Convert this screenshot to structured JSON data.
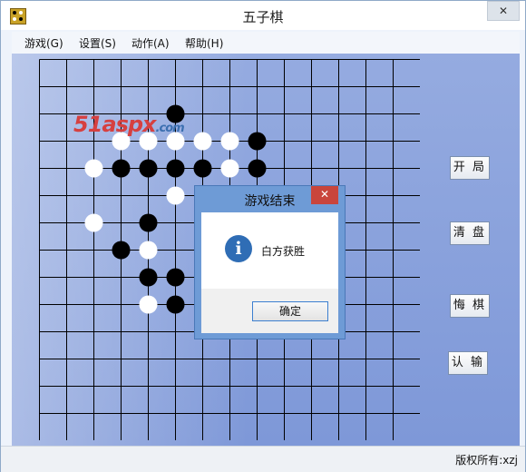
{
  "window": {
    "title": "五子棋",
    "close_label": "✕"
  },
  "menu": [
    {
      "label": "游戏(G)"
    },
    {
      "label": "设置(S)"
    },
    {
      "label": "动作(A)"
    },
    {
      "label": "帮助(H)"
    }
  ],
  "buttons": {
    "start": "开 局",
    "clear": "清 盘",
    "undo": "悔 棋",
    "resign": "认 输"
  },
  "watermark": {
    "main": "51aspx",
    "suffix": ".com"
  },
  "board": {
    "size": 15,
    "black_stones": [
      [
        5,
        2
      ],
      [
        8,
        3
      ],
      [
        3,
        4
      ],
      [
        4,
        4
      ],
      [
        5,
        4
      ],
      [
        6,
        4
      ],
      [
        8,
        4
      ],
      [
        4,
        6
      ],
      [
        3,
        7
      ],
      [
        4,
        8
      ],
      [
        5,
        8
      ],
      [
        5,
        9
      ]
    ],
    "white_stones": [
      [
        3,
        3
      ],
      [
        4,
        3
      ],
      [
        5,
        3
      ],
      [
        6,
        3
      ],
      [
        7,
        3
      ],
      [
        2,
        4
      ],
      [
        7,
        4
      ],
      [
        5,
        5
      ],
      [
        2,
        6
      ],
      [
        4,
        7
      ],
      [
        4,
        9
      ]
    ]
  },
  "dialog": {
    "title": "游戏结束",
    "close_label": "✕",
    "icon": "info-icon",
    "message": "白方获胜",
    "ok_label": "确定"
  },
  "status": {
    "text": "版权所有:xzj"
  },
  "colors": {
    "board_bg": "#8ba2dc",
    "grid_line": "#000000",
    "black": "#000000",
    "white": "#ffffff",
    "dialog_frame": "#6e9bd6",
    "close_red": "#c9453c"
  }
}
